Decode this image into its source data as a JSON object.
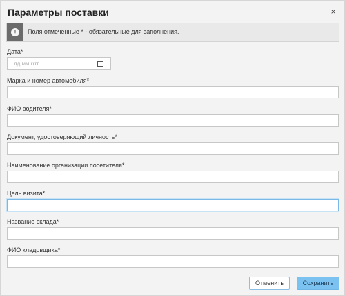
{
  "dialog": {
    "title": "Параметры поставки",
    "close_glyph": "×"
  },
  "notice": {
    "icon": "info-icon",
    "icon_glyph": "!",
    "text": "Поля отмеченные * - обязательные для заполнения."
  },
  "fields": {
    "date": {
      "label": "Дата*",
      "placeholder": "дд.мм.гггг",
      "icon": "calendar-icon"
    },
    "car": {
      "label": "Марка и номер автомобиля*",
      "value": ""
    },
    "driver": {
      "label": "ФИО водителя*",
      "value": ""
    },
    "document": {
      "label": "Документ, удостоверяющий личность*",
      "value": ""
    },
    "organization": {
      "label": "Наименование организации посетителя*",
      "value": ""
    },
    "purpose": {
      "label": "Цель визита*",
      "value": ""
    },
    "warehouse": {
      "label": "Название склада*",
      "value": ""
    },
    "storekeeper": {
      "label": "ФИО кладовщика*",
      "value": ""
    }
  },
  "buttons": {
    "cancel_label": "Отменить",
    "save_label": "Сохранить"
  },
  "colors": {
    "accent": "#7cc2f0",
    "focus_border": "#7ab8e6"
  }
}
